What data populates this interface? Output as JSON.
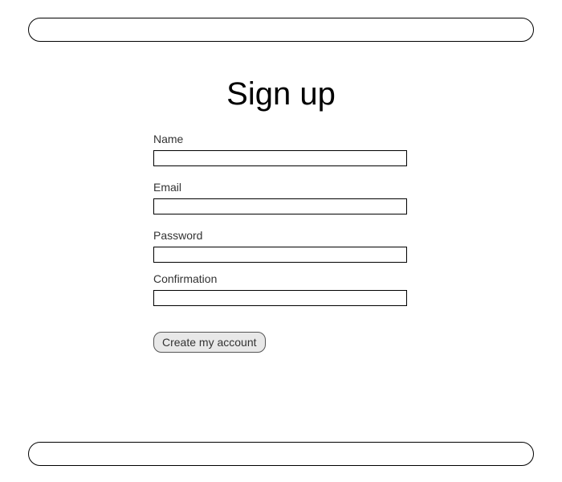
{
  "page": {
    "title": "Sign up"
  },
  "form": {
    "name": {
      "label": "Name",
      "value": ""
    },
    "email": {
      "label": "Email",
      "value": ""
    },
    "password": {
      "label": "Password",
      "value": ""
    },
    "confirmation": {
      "label": "Confirmation",
      "value": ""
    },
    "submit_label": "Create my account"
  }
}
